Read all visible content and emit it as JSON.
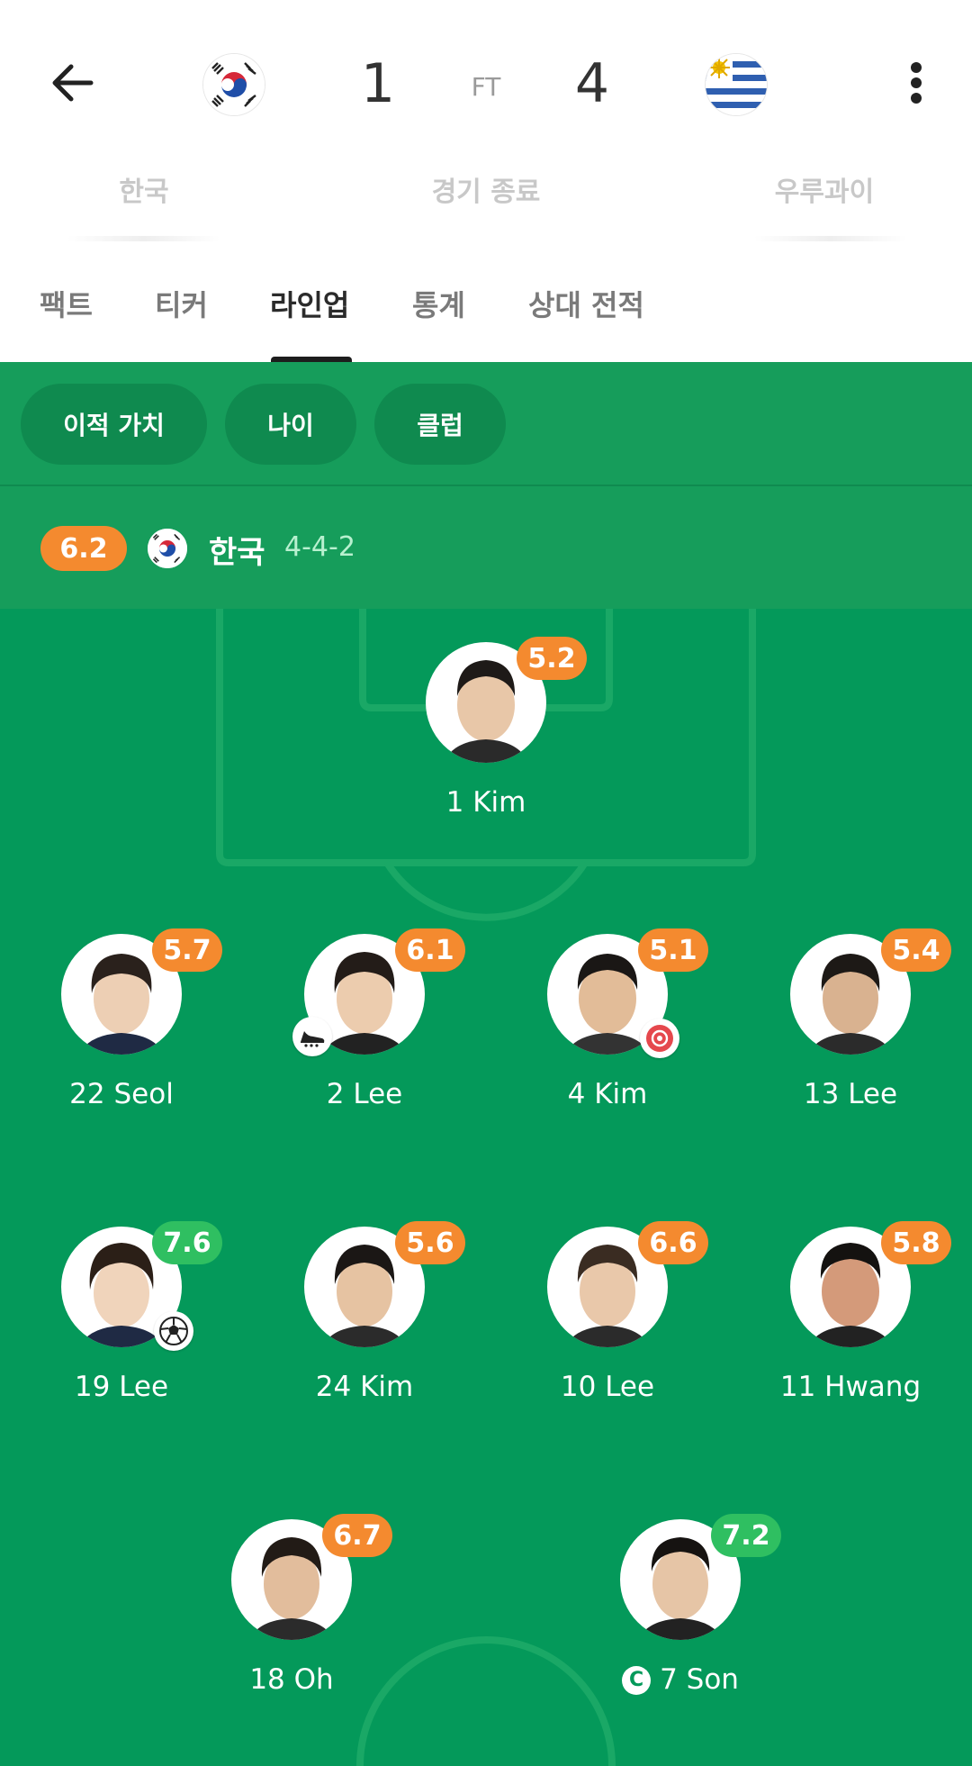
{
  "header": {
    "home_score": "1",
    "away_score": "4",
    "status_short": "FT",
    "home_team": "한국",
    "away_team": "우루과이",
    "status_long": "경기 종료"
  },
  "tabs": [
    {
      "label": "팩트",
      "active": false
    },
    {
      "label": "티커",
      "active": false
    },
    {
      "label": "라인업",
      "active": true
    },
    {
      "label": "통계",
      "active": false
    },
    {
      "label": "상대 전적",
      "active": false
    }
  ],
  "filters": [
    "이적 가치",
    "나이",
    "클럽"
  ],
  "team": {
    "rating": "6.2",
    "name": "한국",
    "formation": "4-4-2"
  },
  "players": [
    {
      "number_name": "1 Kim",
      "rating": "5.2",
      "rating_color": "orange"
    },
    {
      "number_name": "22 Seol",
      "rating": "5.7",
      "rating_color": "orange"
    },
    {
      "number_name": "2 Lee",
      "rating": "6.1",
      "rating_color": "orange",
      "badge": "boot-icon"
    },
    {
      "number_name": "4 Kim",
      "rating": "5.1",
      "rating_color": "orange",
      "badge": "own-goal-icon"
    },
    {
      "number_name": "13 Lee",
      "rating": "5.4",
      "rating_color": "orange"
    },
    {
      "number_name": "19 Lee",
      "rating": "7.6",
      "rating_color": "green",
      "badge": "goal-ball-icon"
    },
    {
      "number_name": "24 Kim",
      "rating": "5.6",
      "rating_color": "orange"
    },
    {
      "number_name": "10 Lee",
      "rating": "6.6",
      "rating_color": "orange"
    },
    {
      "number_name": "11 Hwang",
      "rating": "5.8",
      "rating_color": "orange"
    },
    {
      "number_name": "18 Oh",
      "rating": "6.7",
      "rating_color": "orange"
    },
    {
      "number_name": "7 Son",
      "rating": "7.2",
      "rating_color": "green",
      "captain_mark": "C"
    }
  ],
  "colors": {
    "pitch": "#04995a",
    "panel": "#169d5b",
    "chip": "#0f8a4f",
    "rating_orange": "#f48a2f",
    "rating_green": "#2fbf61"
  }
}
